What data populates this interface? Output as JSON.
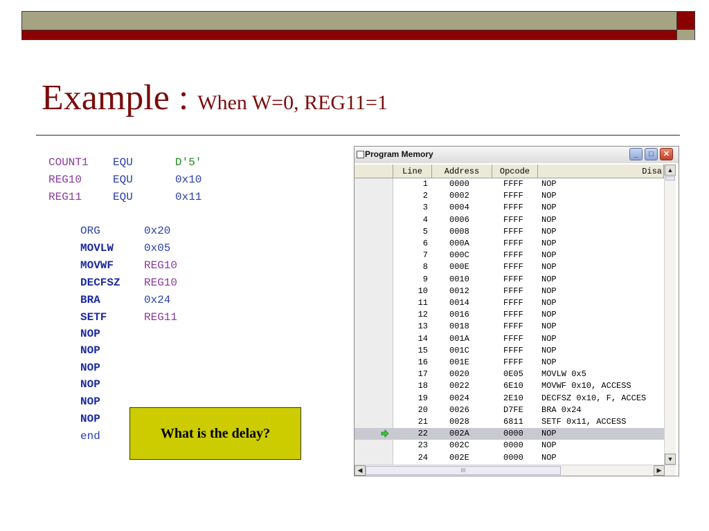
{
  "title": {
    "main": "Example : ",
    "sub": "When W=0, REG11=1"
  },
  "code": {
    "equ": [
      {
        "name": "COUNT1",
        "op": "EQU",
        "val": "D'5'"
      },
      {
        "name": "REG10",
        "op": "EQU",
        "val": "0x10"
      },
      {
        "name": "REG11",
        "op": "EQU",
        "val": "0x11"
      }
    ],
    "instructions": [
      {
        "mn": "ORG",
        "arg": "0x20"
      },
      {
        "mn": "MOVLW",
        "arg": "0x05"
      },
      {
        "mn": "MOVWF",
        "arg": "REG10"
      },
      {
        "mn": "DECFSZ",
        "arg": "REG10"
      },
      {
        "mn": "BRA",
        "arg": "0x24"
      },
      {
        "mn": "SETF",
        "arg": "REG11"
      },
      {
        "mn": "NOP",
        "arg": ""
      },
      {
        "mn": "NOP",
        "arg": ""
      },
      {
        "mn": "NOP",
        "arg": ""
      },
      {
        "mn": "NOP",
        "arg": ""
      },
      {
        "mn": "NOP",
        "arg": ""
      },
      {
        "mn": "NOP",
        "arg": ""
      },
      {
        "mn": "end",
        "arg": ""
      }
    ]
  },
  "callout": "What is the delay?",
  "window": {
    "title": "Program Memory",
    "columns": [
      "Line",
      "Address",
      "Opcode",
      "Disa"
    ],
    "rows": [
      {
        "line": "1",
        "address": "0000",
        "opcode": "FFFF",
        "disasm": "NOP"
      },
      {
        "line": "2",
        "address": "0002",
        "opcode": "FFFF",
        "disasm": "NOP"
      },
      {
        "line": "3",
        "address": "0004",
        "opcode": "FFFF",
        "disasm": "NOP"
      },
      {
        "line": "4",
        "address": "0006",
        "opcode": "FFFF",
        "disasm": "NOP"
      },
      {
        "line": "5",
        "address": "0008",
        "opcode": "FFFF",
        "disasm": "NOP"
      },
      {
        "line": "6",
        "address": "000A",
        "opcode": "FFFF",
        "disasm": "NOP"
      },
      {
        "line": "7",
        "address": "000C",
        "opcode": "FFFF",
        "disasm": "NOP"
      },
      {
        "line": "8",
        "address": "000E",
        "opcode": "FFFF",
        "disasm": "NOP"
      },
      {
        "line": "9",
        "address": "0010",
        "opcode": "FFFF",
        "disasm": "NOP"
      },
      {
        "line": "10",
        "address": "0012",
        "opcode": "FFFF",
        "disasm": "NOP"
      },
      {
        "line": "11",
        "address": "0014",
        "opcode": "FFFF",
        "disasm": "NOP"
      },
      {
        "line": "12",
        "address": "0016",
        "opcode": "FFFF",
        "disasm": "NOP"
      },
      {
        "line": "13",
        "address": "0018",
        "opcode": "FFFF",
        "disasm": "NOP"
      },
      {
        "line": "14",
        "address": "001A",
        "opcode": "FFFF",
        "disasm": "NOP"
      },
      {
        "line": "15",
        "address": "001C",
        "opcode": "FFFF",
        "disasm": "NOP"
      },
      {
        "line": "16",
        "address": "001E",
        "opcode": "FFFF",
        "disasm": "NOP"
      },
      {
        "line": "17",
        "address": "0020",
        "opcode": "0E05",
        "disasm": "MOVLW 0x5"
      },
      {
        "line": "18",
        "address": "0022",
        "opcode": "6E10",
        "disasm": "MOVWF 0x10, ACCESS"
      },
      {
        "line": "19",
        "address": "0024",
        "opcode": "2E10",
        "disasm": "DECFSZ 0x10, F, ACCES"
      },
      {
        "line": "20",
        "address": "0026",
        "opcode": "D7FE",
        "disasm": "BRA 0x24"
      },
      {
        "line": "21",
        "address": "0028",
        "opcode": "6811",
        "disasm": "SETF 0x11, ACCESS"
      },
      {
        "line": "22",
        "address": "002A",
        "opcode": "0000",
        "disasm": "NOP",
        "current": true
      },
      {
        "line": "23",
        "address": "002C",
        "opcode": "0000",
        "disasm": "NOP"
      },
      {
        "line": "24",
        "address": "002E",
        "opcode": "0000",
        "disasm": "NOP"
      }
    ],
    "hscroll_thumb": "III"
  },
  "colors": {
    "title": "#7a0c0c",
    "bar_red": "#8b0000",
    "bar_olive": "#a6a383",
    "callout_bg": "#cccc00",
    "current_row": "#c9c9d2",
    "pc_arrow": "#33cc33"
  },
  "icons": {
    "pc_marker": "green-arrow-icon",
    "minimize": "minimize-icon",
    "maximize": "maximize-icon",
    "close": "close-icon"
  }
}
